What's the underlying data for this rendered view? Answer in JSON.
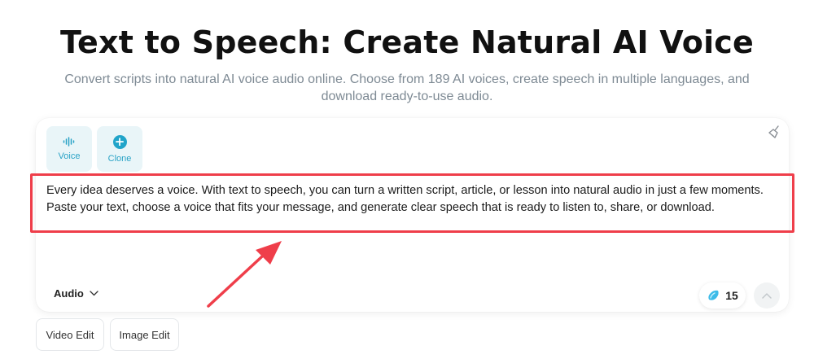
{
  "header": {
    "title": "Text to Speech: Create Natural AI Voice",
    "subtitle": "Convert scripts into natural AI voice audio online. Choose from 189 AI voices, create speech in multiple languages, and download ready-to-use audio."
  },
  "toolbar": {
    "voice_label": "Voice",
    "clone_label": "Clone"
  },
  "editor": {
    "text": "Every idea deserves a voice. With text to speech, you can turn a written script, article, or lesson into natural audio in just a few moments. Paste your text, choose a voice that fits your message, and generate clear speech that is ready to listen to, share, or download."
  },
  "footer": {
    "output_type": "Audio",
    "credits": "15"
  },
  "tabs": [
    {
      "label": "Video Edit"
    },
    {
      "label": "Image Edit"
    }
  ],
  "icons": {
    "voice": "waveform-icon",
    "clone": "plus-circle-icon",
    "clear": "clear-broom-icon",
    "output_dropdown": "chevron-down-icon",
    "credits": "gem-icon",
    "submit": "chevron-up-icon"
  },
  "colors": {
    "accent": "#21a4c9",
    "tool_bg": "#e9f5f8",
    "annotation": "#ef3e4a"
  }
}
